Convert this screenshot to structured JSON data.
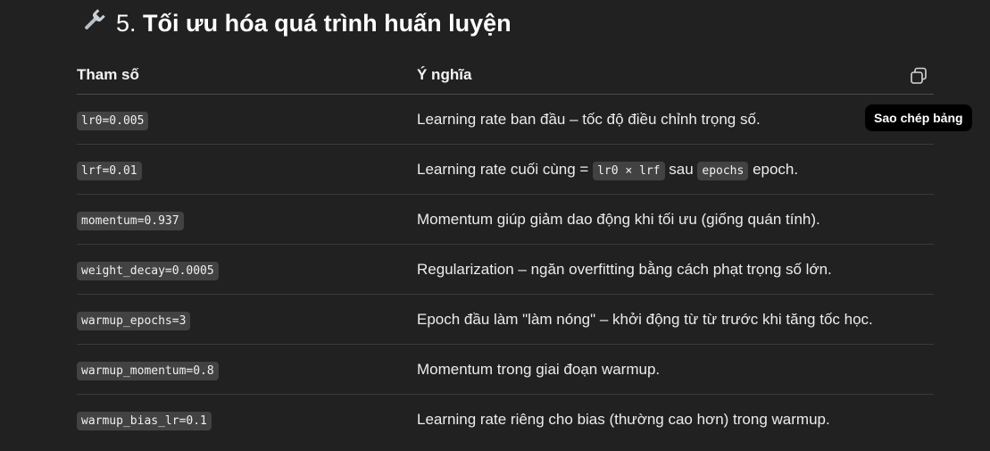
{
  "heading": {
    "icon": "wrench-icon",
    "number": "5.",
    "title": "Tối ưu hóa quá trình huấn luyện"
  },
  "table": {
    "headers": [
      "Tham số",
      "Ý nghĩa"
    ],
    "rows": [
      {
        "param": "lr0=0.005",
        "meaning": [
          {
            "t": "Learning rate ban đầu – tốc độ điều chỉnh trọng số."
          }
        ]
      },
      {
        "param": "lrf=0.01",
        "meaning": [
          {
            "t": "Learning rate cuối cùng = "
          },
          {
            "c": "lr0 × lrf"
          },
          {
            "t": " sau "
          },
          {
            "c": "epochs"
          },
          {
            "t": " epoch."
          }
        ]
      },
      {
        "param": "momentum=0.937",
        "meaning": [
          {
            "t": "Momentum giúp giảm dao động khi tối ưu (giống quán tính)."
          }
        ]
      },
      {
        "param": "weight_decay=0.0005",
        "meaning": [
          {
            "t": "Regularization – ngăn overfitting bằng cách phạt trọng số lớn."
          }
        ]
      },
      {
        "param": "warmup_epochs=3",
        "meaning": [
          {
            "t": "Epoch đầu làm \"làm nóng\" – khởi động từ từ trước khi tăng tốc học."
          }
        ]
      },
      {
        "param": "warmup_momentum=0.8",
        "meaning": [
          {
            "t": "Momentum trong giai đoạn warmup."
          }
        ]
      },
      {
        "param": "warmup_bias_lr=0.1",
        "meaning": [
          {
            "t": "Learning rate riêng cho bias (thường cao hơn) trong warmup."
          }
        ]
      }
    ]
  },
  "copy_button": {
    "icon": "copy-icon",
    "tooltip": "Sao chép bảng"
  }
}
